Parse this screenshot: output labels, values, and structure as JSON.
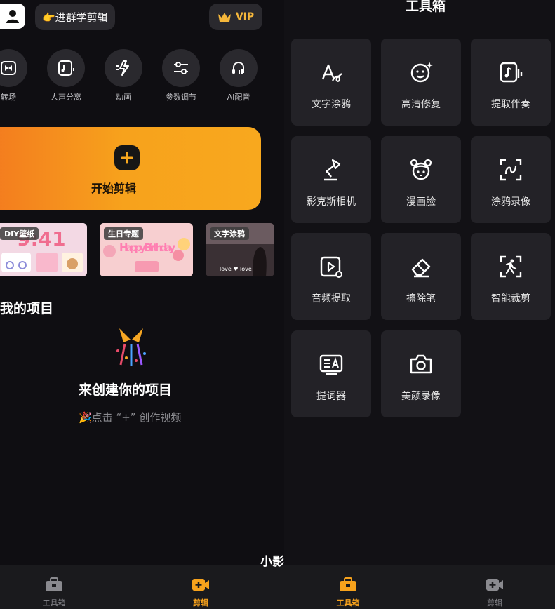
{
  "left": {
    "group_pill": "👉进群学剪辑",
    "vip_label": "VIP",
    "tools": [
      {
        "label": "转场",
        "icon": "transition-icon"
      },
      {
        "label": "人声分离",
        "icon": "vocal-separation-icon"
      },
      {
        "label": "动画",
        "icon": "animation-icon"
      },
      {
        "label": "参数调节",
        "icon": "adjust-icon"
      },
      {
        "label": "AI配音",
        "icon": "ai-dubbing-icon"
      }
    ],
    "start_label": "开始剪辑",
    "templates": [
      {
        "tag": "DIY壁纸",
        "time": "9:41"
      },
      {
        "tag": "生日专题",
        "art": "Happy Birthday"
      },
      {
        "tag": "文字涂鸦",
        "art": "love ♥ love"
      }
    ],
    "section_title": "我的项目",
    "empty_title": "来创建你的项目",
    "empty_sub": "🎉点击 “+” 创作视频",
    "nav": [
      {
        "label": "工具箱",
        "icon": "toolbox-icon",
        "active": false
      },
      {
        "label": "剪辑",
        "icon": "edit-icon",
        "active": true
      }
    ]
  },
  "right": {
    "title": "工具箱",
    "tools": [
      {
        "label": "文字涂鸦",
        "icon": "text-doodle-icon"
      },
      {
        "label": "高清修复",
        "icon": "hd-repair-icon"
      },
      {
        "label": "提取伴奏",
        "icon": "extract-accompaniment-icon"
      },
      {
        "label": "影克斯相机",
        "icon": "lamp-camera-icon"
      },
      {
        "label": "漫画脸",
        "icon": "comic-face-icon"
      },
      {
        "label": "涂鸦录像",
        "icon": "doodle-record-icon"
      },
      {
        "label": "音频提取",
        "icon": "audio-extract-icon"
      },
      {
        "label": "擦除笔",
        "icon": "eraser-icon"
      },
      {
        "label": "智能裁剪",
        "icon": "smart-crop-icon"
      },
      {
        "label": "提词器",
        "icon": "teleprompter-icon"
      },
      {
        "label": "美颜录像",
        "icon": "beauty-camera-icon"
      }
    ],
    "nav": [
      {
        "label": "工具箱",
        "icon": "toolbox-icon",
        "active": true
      },
      {
        "label": "剪辑",
        "icon": "edit-icon",
        "active": false
      }
    ]
  },
  "watermark": "小影",
  "colors": {
    "accent": "#f7a21c",
    "card": "#232227",
    "bg": "#101013"
  }
}
